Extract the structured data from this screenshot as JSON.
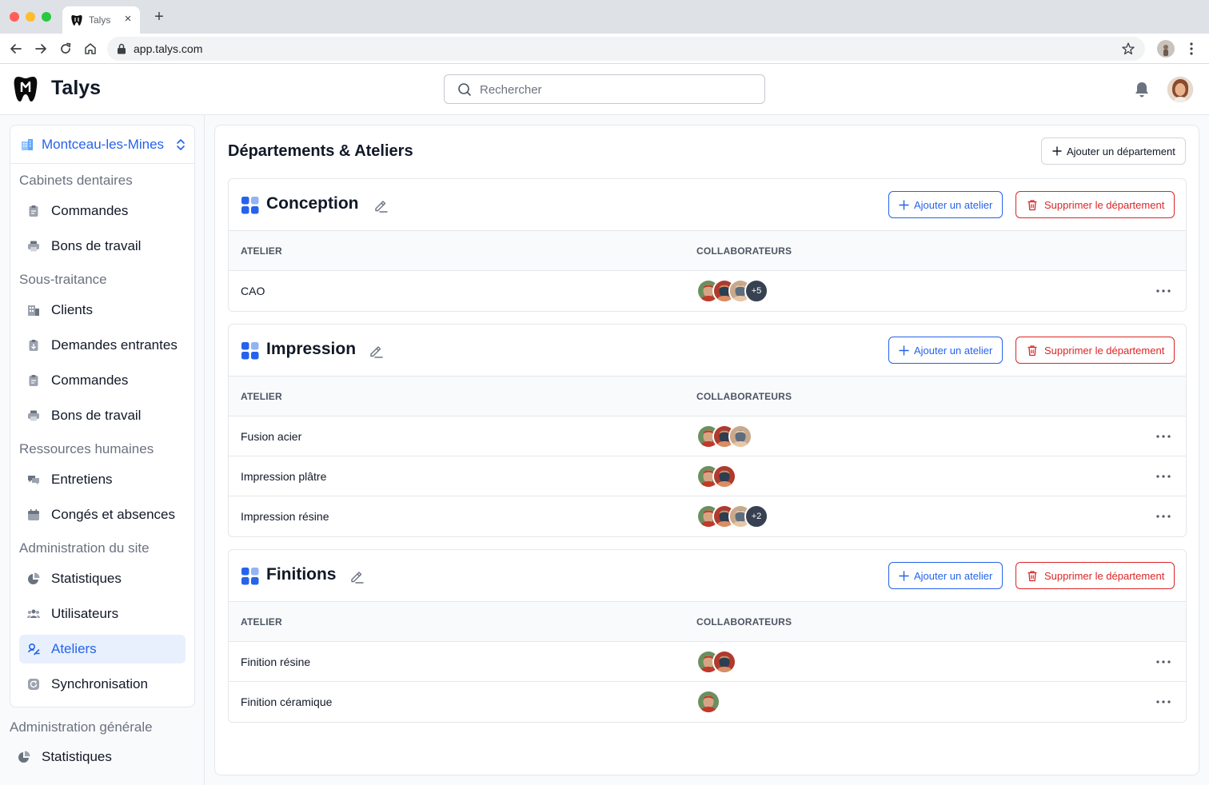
{
  "browser": {
    "tab_title": "Talys",
    "url": "app.talys.com"
  },
  "header": {
    "app_name": "Talys",
    "search_placeholder": "Rechercher"
  },
  "sidebar": {
    "site": "Montceau-les-Mines",
    "sections": {
      "cabinets": "Cabinets dentaires",
      "sous_traitance": "Sous-traitance",
      "rh": "Ressources humaines",
      "admin_site": "Administration du site",
      "admin_generale": "Administration générale"
    },
    "items": {
      "cab_commandes": "Commandes",
      "cab_bons": "Bons de travail",
      "st_clients": "Clients",
      "st_demandes": "Demandes entrantes",
      "st_commandes": "Commandes",
      "st_bons": "Bons de travail",
      "rh_entretiens": "Entretiens",
      "rh_conges": "Congés et absences",
      "as_statistiques": "Statistiques",
      "as_utilisateurs": "Utilisateurs",
      "as_ateliers": "Ateliers",
      "as_synchro": "Synchronisation",
      "ag_statistiques": "Statistiques"
    },
    "active_item": "Ateliers"
  },
  "main": {
    "title": "Départements & Ateliers",
    "add_department_label": "Ajouter un département",
    "add_atelier_label": "Ajouter un atelier",
    "delete_department_label": "Supprimer le département",
    "col_atelier": "ATELIER",
    "col_collaborateurs": "COLLABORATEURS",
    "departments": [
      {
        "name": "Conception",
        "ateliers": [
          {
            "name": "CAO",
            "avatars": 3,
            "more": "+5"
          }
        ]
      },
      {
        "name": "Impression",
        "ateliers": [
          {
            "name": "Fusion acier",
            "avatars": 3,
            "more": ""
          },
          {
            "name": "Impression plâtre",
            "avatars": 2,
            "more": ""
          },
          {
            "name": "Impression résine",
            "avatars": 3,
            "more": "+2"
          }
        ]
      },
      {
        "name": "Finitions",
        "ateliers": [
          {
            "name": "Finition résine",
            "avatars": 2,
            "more": ""
          },
          {
            "name": "Finition céramique",
            "avatars": 1,
            "more": ""
          }
        ]
      }
    ]
  },
  "colors": {
    "accent": "#2563eb",
    "danger": "#dc2626",
    "active_bg": "#e8f0fe",
    "more_badge": "#374151"
  },
  "icons": {
    "site": "building-icon",
    "commandes": "clipboard-icon",
    "bons": "printer-icon",
    "clients": "buildings-icon",
    "demandes": "clipboard-arrow-icon",
    "entretiens": "chat-bubbles-icon",
    "conges": "calendar-icon",
    "statistiques": "pie-chart-icon",
    "utilisateurs": "users-icon",
    "ateliers": "workshop-icon",
    "synchronisation": "refresh-icon",
    "department": "grid-icon",
    "edit": "pencil-icon",
    "delete": "trash-icon",
    "row_menu": "more-horizontal-icon"
  }
}
